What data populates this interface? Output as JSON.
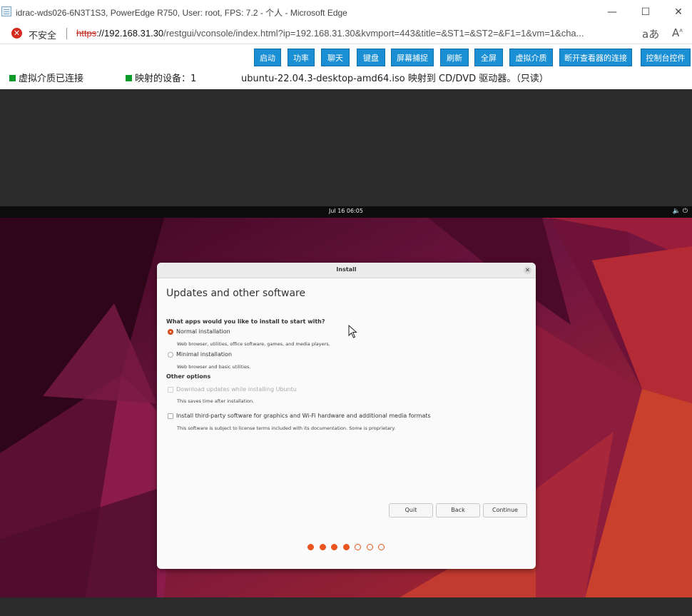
{
  "window": {
    "title": "idrac-wds026-6N3T1S3, PowerEdge R750, User: root, FPS: 7.2 - 个人 - Microsoft Edge",
    "controls": {
      "minimize": "—",
      "maximize": "☐",
      "close": "✕"
    }
  },
  "address_bar": {
    "security_label": "不安全",
    "url_scheme": "https",
    "url_host": "://192.168.31.30",
    "url_rest": "/restgui/vconsole/index.html?ip=192.168.31.30&kvmport=443&title=&ST1=&ST2=&F1=1&vm=1&cha...",
    "icons": [
      "read-aloud-icon",
      "font-icon"
    ]
  },
  "toolbar": {
    "buttons": [
      "启动",
      "功率",
      "聊天",
      "键盘",
      "屏幕捕捉",
      "刷新",
      "全屏",
      "虚拟介质",
      "断开查看器的连接",
      "控制台控件"
    ],
    "status_virtual_media": "虚拟介质已连接",
    "status_mapped": "映射的设备：1",
    "status_iso": "ubuntu-22.04.3-desktop-amd64.iso 映射到 CD/DVD 驱动器。（只读）",
    "status_color": "#0a9a2c"
  },
  "gnome": {
    "clock": "Jul 16  06:05",
    "sys_icons": [
      "speaker-icon",
      "power-icon"
    ]
  },
  "installer": {
    "window_title": "Install",
    "heading": "Updates and other software",
    "question": "What apps would you like to install to start with?",
    "options": [
      {
        "label": "Normal installation",
        "desc": "Web browser, utilities, office software, games, and media players.",
        "selected": true
      },
      {
        "label": "Minimal installation",
        "desc": "Web browser and basic utilities.",
        "selected": false
      }
    ],
    "other_heading": "Other options",
    "checkboxes": [
      {
        "label": "Download updates while installing Ubuntu",
        "desc": "This saves time after installation.",
        "checked": false,
        "enabled": false
      },
      {
        "label": "Install third-party software for graphics and Wi-Fi hardware and additional media formats",
        "desc": "This software is subject to license terms included with its documentation. Some is proprietary.",
        "checked": false,
        "enabled": true
      }
    ],
    "buttons": {
      "quit": "Quit",
      "back": "Back",
      "continue": "Continue"
    },
    "progress": {
      "completed": 4,
      "total": 7
    },
    "accent": "#e95420"
  }
}
